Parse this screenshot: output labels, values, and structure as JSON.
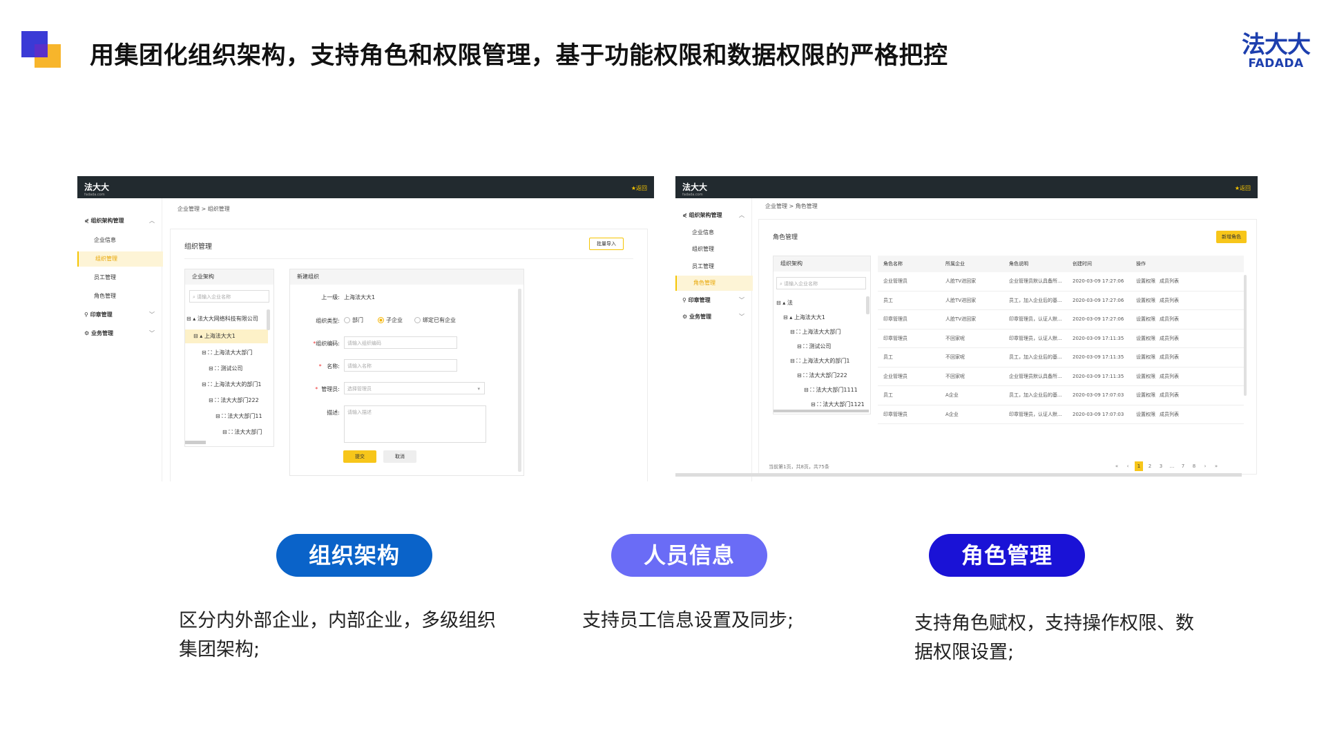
{
  "header": {
    "title": "用集团化组织架构，支持角色和权限管理，基于功能权限和数据权限的严格把控",
    "brand_cn": "法大大",
    "brand_en": "FADADA"
  },
  "left_shot": {
    "logo": "法大大",
    "logo_sub": "fadada.com",
    "back": "返回",
    "sidebar": [
      {
        "label": "组织架构管理"
      },
      {
        "label": "企业信息"
      },
      {
        "label": "组织管理"
      },
      {
        "label": "员工管理"
      },
      {
        "label": "角色管理"
      },
      {
        "label": "印章管理"
      },
      {
        "label": "业务管理"
      }
    ],
    "breadcrumb": "企业管理  >  组织管理",
    "card_title": "组织管理",
    "import_btn": "批量导入",
    "tree_panel": {
      "title": "企业架构",
      "search_placeholder": "请输入企业名称",
      "nodes": [
        "法大大网络科技有限公司",
        "上海法大大1",
        "上海法大大部门",
        "测试公司",
        "上海法大大的部门1",
        "法大大部门222",
        "法大大部门11",
        "法大大部门"
      ]
    },
    "form": {
      "title": "新建组织",
      "parent_label": "上一级:",
      "parent_value": "上海法大大1",
      "type_label": "组织类型:",
      "type_options": [
        "部门",
        "子企业",
        "绑定已有企业"
      ],
      "code_label": "组织编码:",
      "code_placeholder": "请输入组织编码",
      "name_label": "名称:",
      "name_placeholder": "请输入名称",
      "admin_label": "管理员:",
      "admin_placeholder": "选择管理员",
      "desc_label": "描述:",
      "desc_placeholder": "请输入描述",
      "submit": "提交",
      "cancel": "取消"
    }
  },
  "right_shot": {
    "logo": "法大大",
    "logo_sub": "fadada.com",
    "back": "返回",
    "sidebar": [
      {
        "label": "组织架构管理"
      },
      {
        "label": "企业信息"
      },
      {
        "label": "组织管理"
      },
      {
        "label": "员工管理"
      },
      {
        "label": "角色管理"
      },
      {
        "label": "印章管理"
      },
      {
        "label": "业务管理"
      }
    ],
    "breadcrumb": "企业管理  >  角色管理",
    "card_title": "角色管理",
    "new_btn": "新增角色",
    "tree_panel": {
      "title": "组织架构",
      "search_placeholder": "请输入企业名称",
      "nodes": [
        "法",
        "上海法大大1",
        "上海法大大部门",
        "测试公司",
        "上海法大大的部门1",
        "法大大部门222",
        "法大大部门1111",
        "法大大部门1121"
      ]
    },
    "table": {
      "columns": [
        "角色名称",
        "所属企业",
        "角色说明",
        "创建时间",
        "操作"
      ],
      "rows": [
        [
          "企业管理员",
          "人脸TV进回家",
          "企业管理员默认具备所...",
          "2020-03-09 17:27:06"
        ],
        [
          "员工",
          "人脸TV进回家",
          "员工，加入企业后的基...",
          "2020-03-09 17:27:06"
        ],
        [
          "印章管理员",
          "人脸TV进回家",
          "印章管理员，认证人默...",
          "2020-03-09 17:27:06"
        ],
        [
          "印章管理员",
          "不回家呢",
          "印章管理员，认证人默...",
          "2020-03-09 17:11:35"
        ],
        [
          "员工",
          "不回家呢",
          "员工，加入企业后的基...",
          "2020-03-09 17:11:35"
        ],
        [
          "企业管理员",
          "不回家呢",
          "企业管理员默认具备所...",
          "2020-03-09 17:11:35"
        ],
        [
          "员工",
          "A企业",
          "员工，加入企业后的基...",
          "2020-03-09 17:07:03"
        ],
        [
          "印章管理员",
          "A企业",
          "印章管理员，认证人默...",
          "2020-03-09 17:07:03"
        ]
      ],
      "action_perm": "设置权限",
      "action_members": "成员列表"
    },
    "pager_info": "当前第1页，共8页，共75条",
    "pages": [
      "«",
      "‹",
      "1",
      "2",
      "3",
      "...",
      "7",
      "8",
      "›",
      "»"
    ]
  },
  "features": [
    {
      "pill": "组织架构",
      "color": "#0a63c9",
      "desc_lines": [
        "区分内外部企业，内部企业，多级组织",
        "集团架构;"
      ]
    },
    {
      "pill": "人员信息",
      "color": "#6a6cf6",
      "desc_lines": [
        "支持员工信息设置及同步;"
      ]
    },
    {
      "pill": "角色管理",
      "color": "#1a12d6",
      "desc_lines": [
        "支持角色赋权，支持操作权限、数",
        "据权限设置;"
      ]
    }
  ]
}
